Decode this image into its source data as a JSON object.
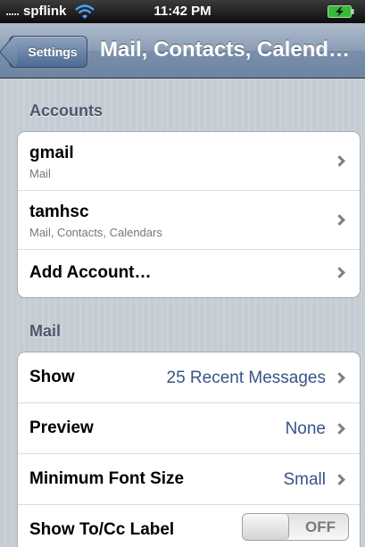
{
  "status_bar": {
    "carrier": "spflink",
    "time": "11:42 PM",
    "signal_icon": "signal-dots-icon",
    "wifi_icon": "wifi-icon",
    "battery_icon": "battery-charging-icon"
  },
  "nav": {
    "back_label": "Settings",
    "title": "Mail, Contacts, Calend…"
  },
  "accounts": {
    "header": "Accounts",
    "items": [
      {
        "title": "gmail",
        "subtitle": "Mail"
      },
      {
        "title": "tamhsc",
        "subtitle": "Mail, Contacts, Calendars"
      },
      {
        "title": "Add Account…"
      }
    ]
  },
  "mail": {
    "header": "Mail",
    "rows": [
      {
        "label": "Show",
        "value": "25 Recent Messages"
      },
      {
        "label": "Preview",
        "value": "None"
      },
      {
        "label": "Minimum Font Size",
        "value": "Small"
      },
      {
        "label": "Show To/Cc Label",
        "toggle": "OFF"
      }
    ]
  },
  "colors": {
    "nav_bar": "#7b8fab",
    "value_text": "#385487",
    "background": "#c5ccd4",
    "section_header": "#4c566c"
  }
}
